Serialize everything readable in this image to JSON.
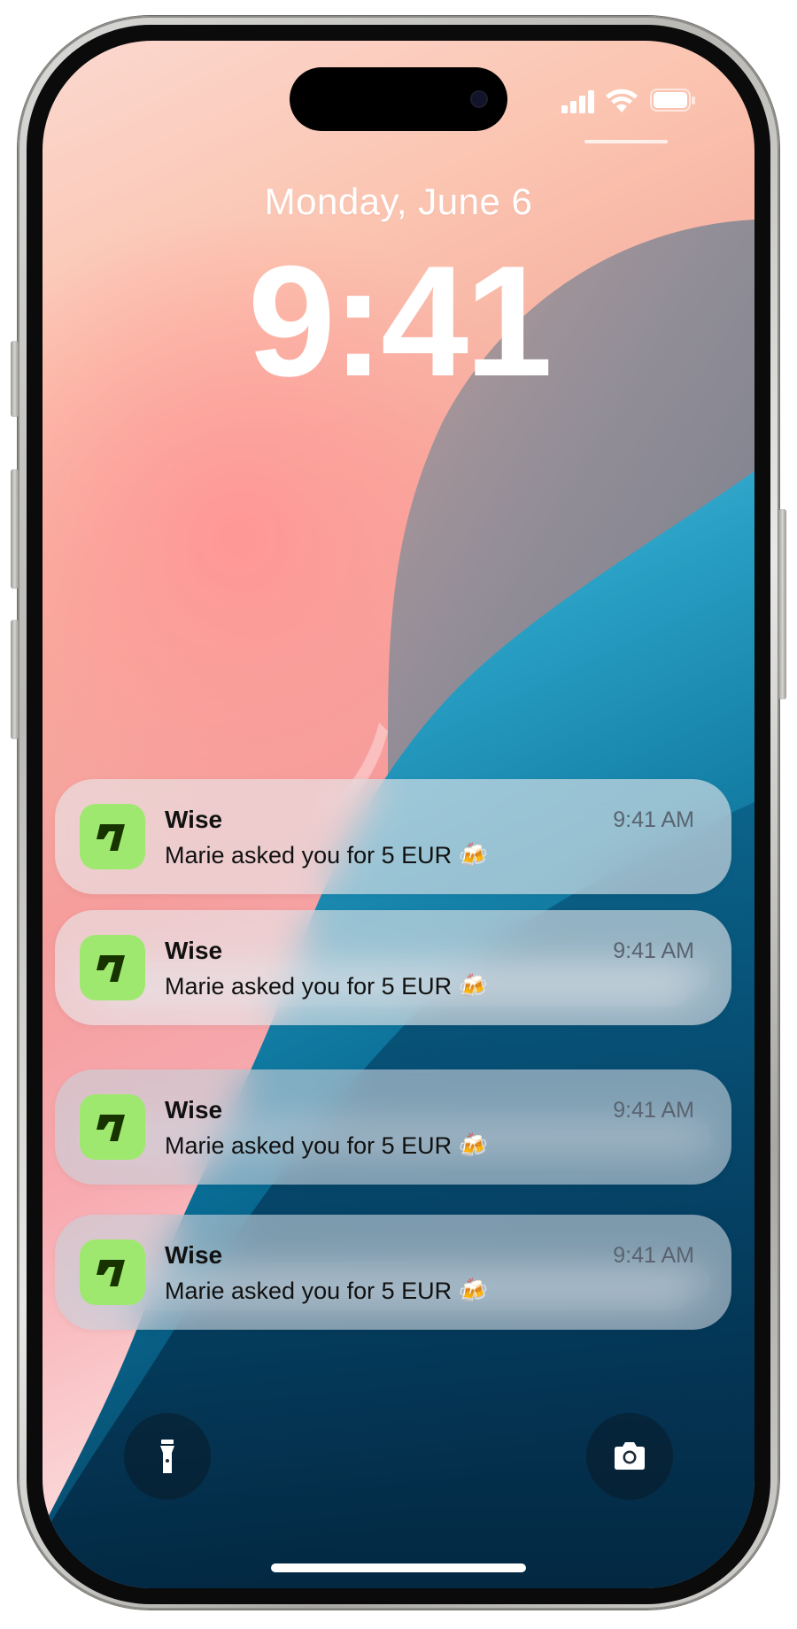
{
  "lock_screen": {
    "date": "Monday, June 6",
    "time": "9:41"
  },
  "status_bar": {
    "icons": [
      "cellular-signal-icon",
      "wifi-icon",
      "battery-icon"
    ]
  },
  "notifications": [
    {
      "app_name": "Wise",
      "time": "9:41 AM",
      "message": "Marie asked you for 5 EUR 🍻"
    },
    {
      "app_name": "Wise",
      "time": "9:41 AM",
      "message": "Marie asked you for 5 EUR 🍻"
    },
    {
      "app_name": "Wise",
      "time": "9:41 AM",
      "message": "Marie asked you for 5 EUR 🍻"
    },
    {
      "app_name": "Wise",
      "time": "9:41 AM",
      "message": "Marie asked you for 5 EUR 🍻"
    }
  ],
  "quick_actions": {
    "left_icon": "flashlight-icon",
    "right_icon": "camera-icon"
  },
  "colors": {
    "wise_green": "#9fe870",
    "wise_dark": "#163300"
  }
}
